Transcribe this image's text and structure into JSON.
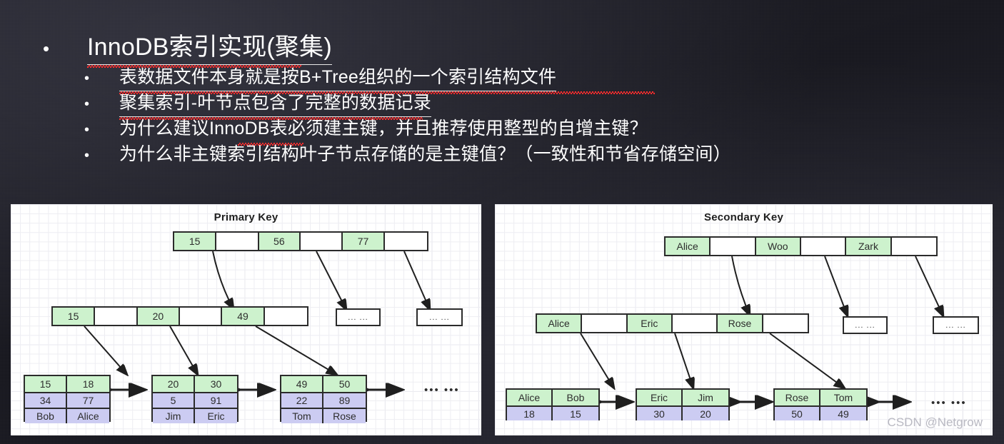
{
  "slide": {
    "bullets": [
      {
        "level": 1,
        "marker": "•",
        "text": "InnoDB索引实现(聚集)"
      },
      {
        "level": 2,
        "marker": "•",
        "text": "表数据文件本身就是按B+Tree组织的一个索引结构文件"
      },
      {
        "level": 2,
        "marker": "•",
        "text": "聚集索引-叶节点包含了完整的数据记录"
      },
      {
        "level": 2,
        "marker": "•",
        "text": "为什么建议InnoDB表必须建主键，并且推荐使用整型的自增主键？"
      },
      {
        "level": 2,
        "marker": "•",
        "text": "为什么非主键索引结构叶子节点存储的是主键值？（一致性和节省存储空间）"
      }
    ],
    "watermark": "CSDN @Netgrow"
  },
  "colors": {
    "key_cell": "#cdf2cd",
    "data_cell": "#ccccf2",
    "node_border": "#2b2b2b",
    "panel_bg": "#ffffff",
    "slide_bg": "#1c1c24"
  },
  "diagrams": {
    "left": {
      "title": "Primary Key",
      "root": {
        "cells": [
          "15",
          "",
          "56",
          "",
          "77",
          ""
        ]
      },
      "internal": {
        "cells": [
          "15",
          "",
          "20",
          "",
          "49",
          ""
        ]
      },
      "internal_stubs": [
        "... ...",
        "... ..."
      ],
      "leaves": [
        {
          "keys": [
            "15",
            "18"
          ],
          "row2": [
            "34",
            "77"
          ],
          "row3": [
            "Bob",
            "Alice"
          ]
        },
        {
          "keys": [
            "20",
            "30"
          ],
          "row2": [
            "5",
            "91"
          ],
          "row3": [
            "Jim",
            "Eric"
          ]
        },
        {
          "keys": [
            "49",
            "50"
          ],
          "row2": [
            "22",
            "89"
          ],
          "row3": [
            "Tom",
            "Rose"
          ]
        }
      ],
      "leaf_ellipsis": "••• •••"
    },
    "right": {
      "title": "Secondary Key",
      "root": {
        "cells": [
          "Alice",
          "",
          "Woo",
          "",
          "Zark",
          ""
        ]
      },
      "internal": {
        "cells": [
          "Alice",
          "",
          "Eric",
          "",
          "Rose",
          ""
        ]
      },
      "internal_stubs": [
        "... ...",
        "... ..."
      ],
      "leaves": [
        {
          "keys": [
            "Alice",
            "Bob"
          ],
          "row2": [
            "18",
            "15"
          ]
        },
        {
          "keys": [
            "Eric",
            "Jim"
          ],
          "row2": [
            "30",
            "20"
          ]
        },
        {
          "keys": [
            "Rose",
            "Tom"
          ],
          "row2": [
            "50",
            "49"
          ]
        }
      ],
      "leaf_ellipsis": "••• •••"
    }
  }
}
